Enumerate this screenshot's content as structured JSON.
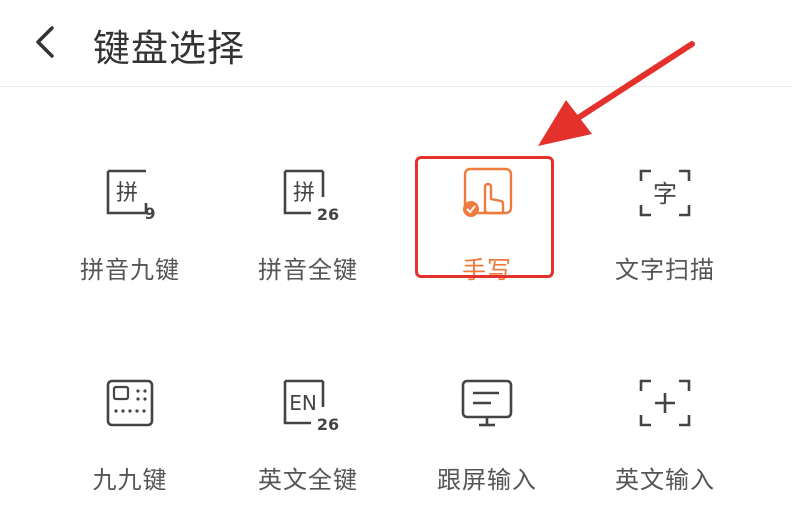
{
  "header": {
    "title": "键盘选择",
    "back_icon": "chevron-left-icon"
  },
  "keyboards": [
    {
      "label": "拼音九键",
      "icon": "pinyin-9-icon",
      "glyph": "拼",
      "sub": "9"
    },
    {
      "label": "拼音全键",
      "icon": "pinyin-26-icon",
      "glyph": "拼",
      "sub": "26"
    },
    {
      "label": "手写",
      "icon": "handwriting-icon",
      "selected": true
    },
    {
      "label": "文字扫描",
      "icon": "text-scan-icon",
      "glyph": "字"
    },
    {
      "label": "九九键",
      "icon": "grid-keyboard-icon"
    },
    {
      "label": "英文全键",
      "icon": "english-26-icon",
      "glyph": "EN",
      "sub": "26"
    },
    {
      "label": "跟屏输入",
      "icon": "screen-input-icon"
    },
    {
      "label": "英文输入",
      "icon": "add-input-icon"
    }
  ],
  "colors": {
    "accent": "#f07a3c",
    "highlight": "#e5312c",
    "icon": "#444444"
  }
}
